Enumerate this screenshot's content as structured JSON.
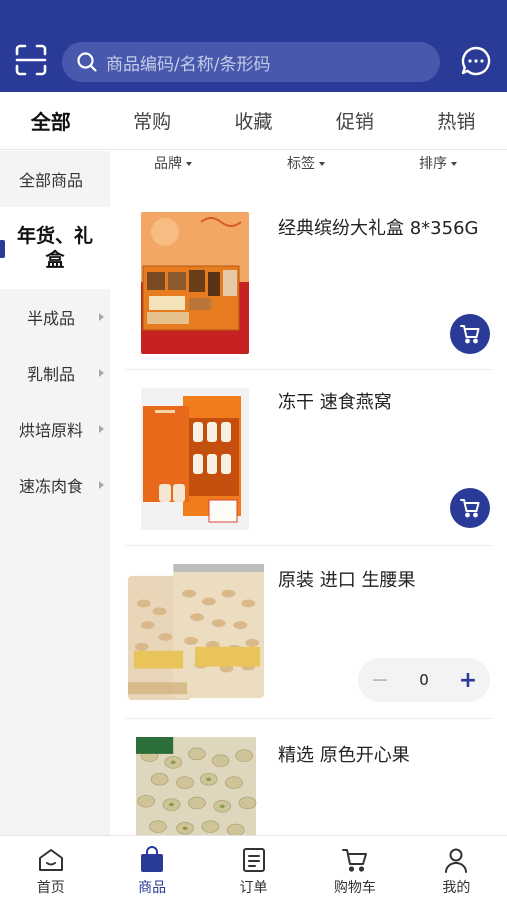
{
  "search": {
    "placeholder": "商品编码/名称/条形码"
  },
  "tabs": [
    {
      "label": "全部"
    },
    {
      "label": "常购"
    },
    {
      "label": "收藏"
    },
    {
      "label": "促销"
    },
    {
      "label": "热销"
    }
  ],
  "sidebar": {
    "items": [
      {
        "label": "全部商品"
      },
      {
        "label": "年货、礼盒"
      },
      {
        "label": "半成品"
      },
      {
        "label": "乳制品"
      },
      {
        "label": "烘培原料"
      },
      {
        "label": "速冻肉食"
      }
    ]
  },
  "filters": {
    "brand": "品牌",
    "tag": "标签",
    "sort": "排序"
  },
  "products": [
    {
      "name": "经典缤纷大礼盒 8*356G"
    },
    {
      "name": "冻干 速食燕窝"
    },
    {
      "name": "原装 进口 生腰果",
      "quantity": "0",
      "minus": "−",
      "plus": "+"
    },
    {
      "name": "精选 原色开心果"
    }
  ],
  "nav": [
    {
      "label": "首页",
      "icon": "home-icon"
    },
    {
      "label": "商品",
      "icon": "bag-icon"
    },
    {
      "label": "订单",
      "icon": "order-icon"
    },
    {
      "label": "购物车",
      "icon": "cart-icon"
    },
    {
      "label": "我的",
      "icon": "user-icon"
    }
  ],
  "colors": {
    "primary": "#2a3a97",
    "search_bg": "#4858ad",
    "sidebar_bg": "#f4f4f4"
  }
}
